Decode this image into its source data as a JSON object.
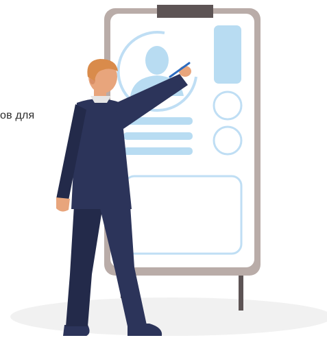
{
  "text_fragment": "ов для",
  "colors": {
    "board_frame": "#b9aca8",
    "board_face": "#ffffff",
    "board_clip": "#5d5455",
    "accent_blue": "#b8dcf2",
    "outline_blue": "#bfdef4",
    "suit": "#2c345a",
    "suit_shadow": "#232a4a",
    "hair": "#d98b4b",
    "skin": "#e8a57c",
    "ground_shadow": "#f0f0f0"
  },
  "icons": [
    "person-silhouette-icon",
    "pen-icon"
  ]
}
